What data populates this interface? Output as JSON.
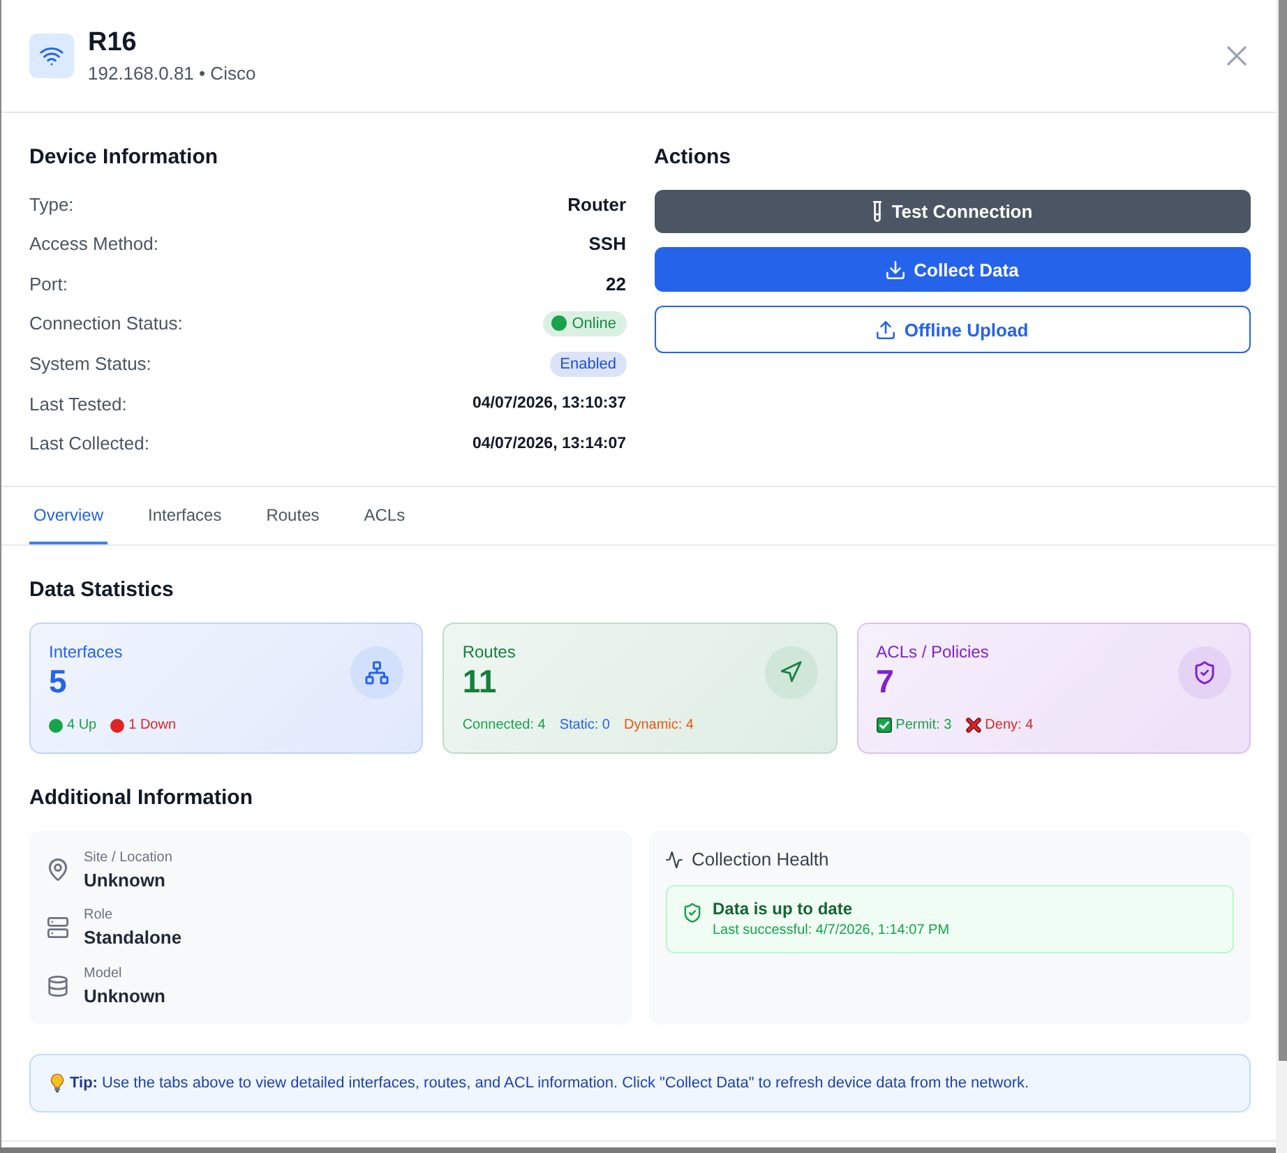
{
  "dialog": {
    "title": "R16",
    "subtitle": "192.168.0.81 • Cisco"
  },
  "device_information": {
    "title": "Device Information",
    "rows": [
      {
        "label": "Type:",
        "value": "Router",
        "kind": "text"
      },
      {
        "label": "Access Method:",
        "value": "SSH",
        "kind": "text"
      },
      {
        "label": "Port:",
        "value": "22",
        "kind": "text"
      },
      {
        "label": "Connection Status:",
        "value": "Online",
        "kind": "status",
        "color": "#16a34a"
      },
      {
        "label": "System Status:",
        "value": "Enabled",
        "kind": "badge",
        "color": "#1d4ed8"
      },
      {
        "label": "Last Tested:",
        "value": "04/07/2026, 13:10:37",
        "kind": "time"
      },
      {
        "label": "Last Collected:",
        "value": "04/07/2026, 13:14:07",
        "kind": "time"
      }
    ]
  },
  "actions": {
    "title": "Actions",
    "buttons": [
      {
        "label": "Test Connection",
        "kind": "test"
      },
      {
        "label": "Collect Data",
        "kind": "collect"
      },
      {
        "label": "Offline Upload",
        "kind": "upload"
      }
    ]
  },
  "tabs": [
    {
      "label": "Overview",
      "selected": true
    },
    {
      "label": "Interfaces",
      "selected": false
    },
    {
      "label": "Routes",
      "selected": false
    },
    {
      "label": "ACLs",
      "selected": false
    }
  ],
  "data_statistics": {
    "title": "Data Statistics",
    "cards": [
      {
        "kind": "interfaces",
        "title": "Interfaces",
        "value": "5",
        "color": "#2563eb",
        "details": [
          {
            "kind": "dot",
            "text": "4 Up",
            "color": "#16a34a"
          },
          {
            "kind": "dot",
            "text": "1 Down",
            "color": "#dc2626"
          }
        ]
      },
      {
        "kind": "routes",
        "title": "Routes",
        "value": "11",
        "color": "#15803d",
        "details": [
          {
            "kind": "plain",
            "text": "Connected: 4",
            "color": "#16a34a"
          },
          {
            "kind": "plain",
            "text": "Static: 0",
            "color": "#2563eb"
          },
          {
            "kind": "plain",
            "text": "Dynamic: 4",
            "color": "#ea580c"
          }
        ]
      },
      {
        "kind": "acls",
        "title": "ACLs / Policies",
        "value": "7",
        "color": "#7e22ce",
        "details": [
          {
            "kind": "check",
            "text": "Permit: 3",
            "color": "#16a34a"
          },
          {
            "kind": "cross",
            "text": "Deny: 4",
            "color": "#dc2626"
          }
        ]
      }
    ]
  },
  "additional_information": {
    "title": "Additional Information",
    "items": [
      {
        "kind": "location",
        "label": "Site / Location",
        "value": "Unknown"
      },
      {
        "kind": "role",
        "label": "Role",
        "value": "Standalone"
      },
      {
        "kind": "model",
        "label": "Model",
        "value": "Unknown"
      }
    ],
    "collection_health": {
      "title": "Collection Health",
      "status": {
        "kind": "ok",
        "title": "Data is up to date",
        "detail": "Last successful: 4/7/2026, 1:14:07 PM"
      }
    }
  },
  "tip": "**Tip:** Use the tabs above to view detailed interfaces, routes, and ACL information. Click \"Collect Data\" to refresh device data from the network."
}
